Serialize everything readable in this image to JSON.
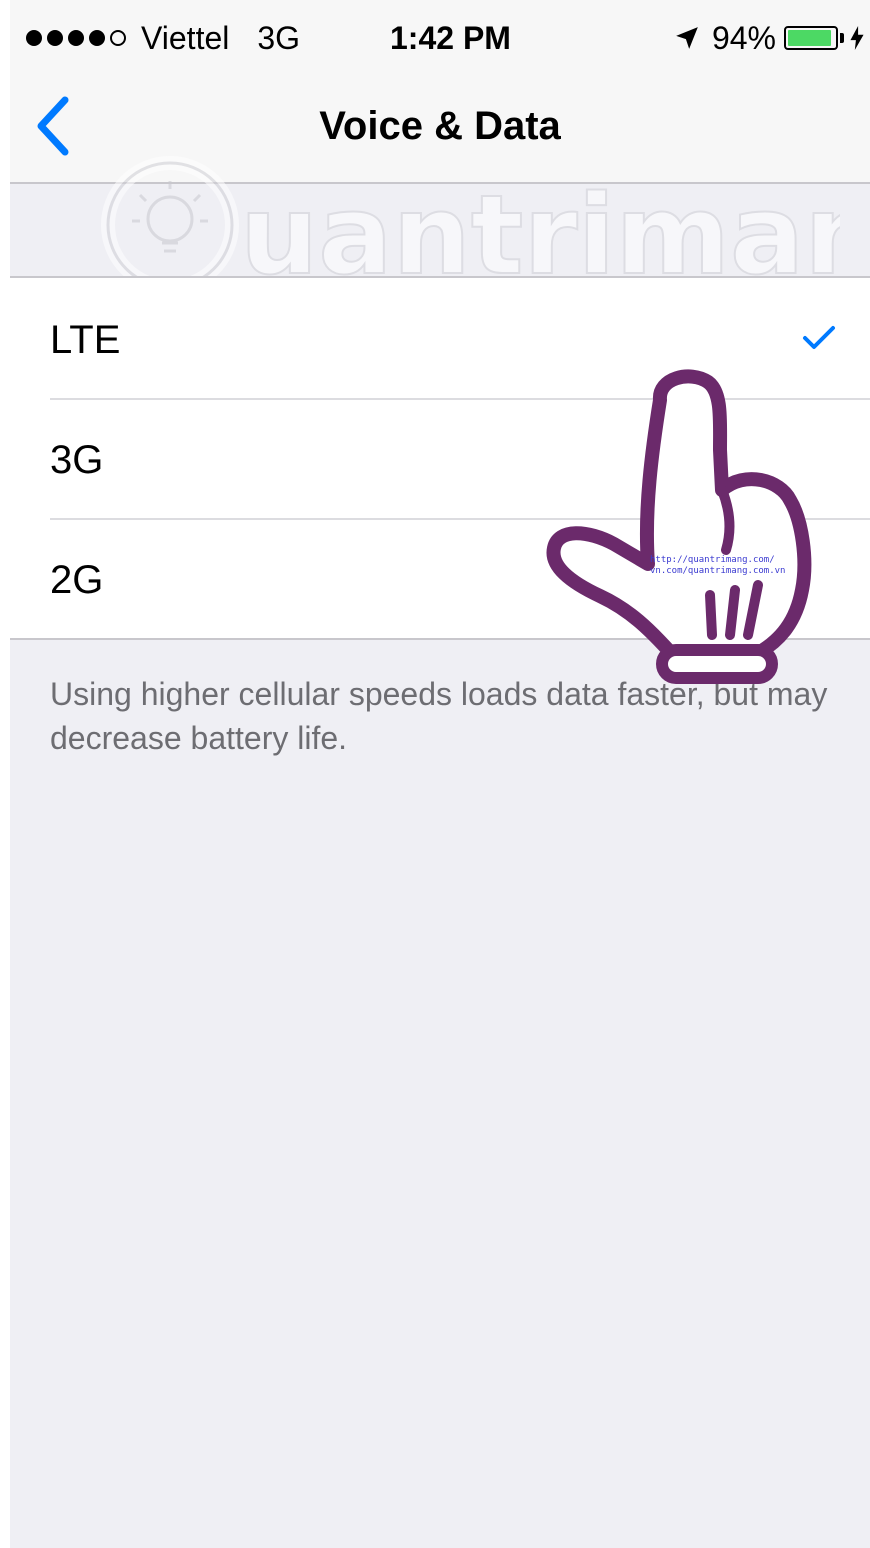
{
  "status_bar": {
    "carrier": "Viettel",
    "network": "3G",
    "time": "1:42 PM",
    "battery_percent": "94%",
    "battery_level": 0.94,
    "icons": [
      "signal-dots",
      "location-arrow-icon",
      "battery-icon",
      "charging-bolt-icon"
    ]
  },
  "nav": {
    "back_icon": "chevron-left-icon",
    "title": "Voice & Data"
  },
  "options": [
    {
      "label": "LTE",
      "selected": true
    },
    {
      "label": "3G",
      "selected": false
    },
    {
      "label": "2G",
      "selected": false
    }
  ],
  "footer": "Using higher cellular speeds loads data faster, but may decrease battery life.",
  "watermark": {
    "brand": "Quantrimang",
    "hand_text": "http://quantrimang.com/ vn.com/quantrimang.com.vn"
  },
  "colors": {
    "accent": "#007aff",
    "background": "#efeff4",
    "battery": "#4cd964",
    "hand_outline": "#6b2a6b",
    "footer_text": "#6d6d72"
  }
}
